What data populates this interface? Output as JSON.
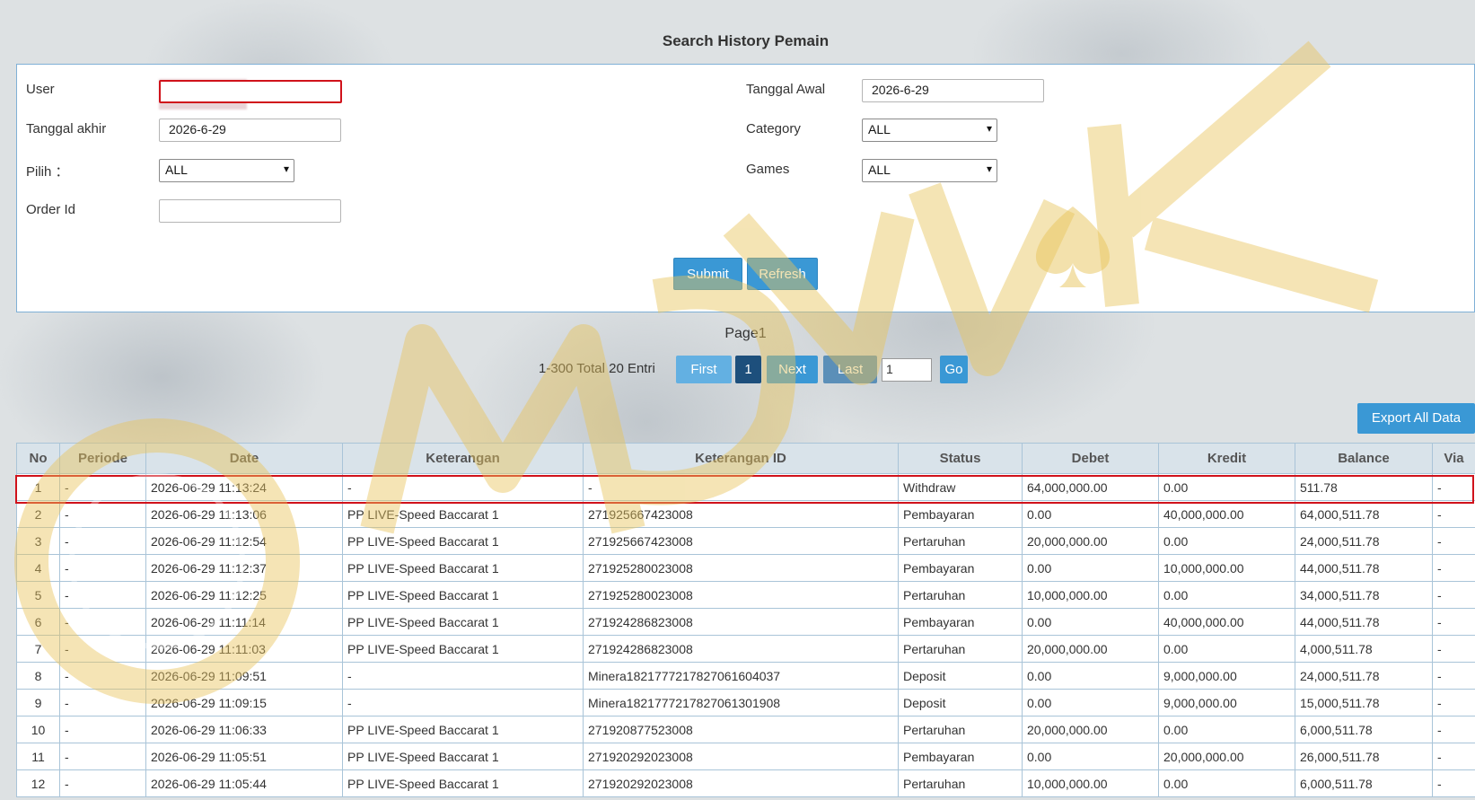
{
  "title": "Search History Pemain",
  "form": {
    "user_label": "User",
    "user_value": "",
    "tanggal_awal_label": "Tanggal Awal",
    "tanggal_awal_value": "2026-6-29",
    "tanggal_akhir_label": "Tanggal akhir",
    "tanggal_akhir_value": "2026-6-29",
    "category_label": "Category",
    "category_value": "ALL",
    "pilih_label": "Pilih ：",
    "pilih_value": "ALL",
    "games_label": "Games",
    "games_value": "ALL",
    "order_id_label": "Order Id",
    "order_id_value": "",
    "submit_label": "Submit",
    "refresh_label": "Refresh"
  },
  "pager": {
    "page_label": "Page1",
    "info": "1-300 Total 20 Entri",
    "first_label": "First",
    "current_page": "1",
    "next_label": "Next",
    "last_label": "Last",
    "page_input_value": "1",
    "go_label": "Go"
  },
  "export_label": "Export All Data",
  "table": {
    "headers": [
      "No",
      "Periode",
      "Date",
      "Keterangan",
      "Keterangan ID",
      "Status",
      "Debet",
      "Kredit",
      "Balance",
      "Via"
    ],
    "rows": [
      [
        "1",
        "-",
        "2026-06-29 11:13:24",
        "-",
        "-",
        "Withdraw",
        "64,000,000.00",
        "0.00",
        "511.78",
        "-"
      ],
      [
        "2",
        "-",
        "2026-06-29 11:13:06",
        "PP LIVE-Speed Baccarat 1",
        "271925667423008",
        "Pembayaran",
        "0.00",
        "40,000,000.00",
        "64,000,511.78",
        "-"
      ],
      [
        "3",
        "-",
        "2026-06-29 11:12:54",
        "PP LIVE-Speed Baccarat 1",
        "271925667423008",
        "Pertaruhan",
        "20,000,000.00",
        "0.00",
        "24,000,511.78",
        "-"
      ],
      [
        "4",
        "-",
        "2026-06-29 11:12:37",
        "PP LIVE-Speed Baccarat 1",
        "271925280023008",
        "Pembayaran",
        "0.00",
        "10,000,000.00",
        "44,000,511.78",
        "-"
      ],
      [
        "5",
        "-",
        "2026-06-29 11:12:25",
        "PP LIVE-Speed Baccarat 1",
        "271925280023008",
        "Pertaruhan",
        "10,000,000.00",
        "0.00",
        "34,000,511.78",
        "-"
      ],
      [
        "6",
        "-",
        "2026-06-29 11:11:14",
        "PP LIVE-Speed Baccarat 1",
        "271924286823008",
        "Pembayaran",
        "0.00",
        "40,000,000.00",
        "44,000,511.78",
        "-"
      ],
      [
        "7",
        "-",
        "2026-06-29 11:11:03",
        "PP LIVE-Speed Baccarat 1",
        "271924286823008",
        "Pertaruhan",
        "20,000,000.00",
        "0.00",
        "4,000,511.78",
        "-"
      ],
      [
        "8",
        "-",
        "2026-06-29 11:09:51",
        "-",
        "Minera1821777217827061604037",
        "Deposit",
        "0.00",
        "9,000,000.00",
        "24,000,511.78",
        "-"
      ],
      [
        "9",
        "-",
        "2026-06-29 11:09:15",
        "-",
        "Minera1821777217827061301908",
        "Deposit",
        "0.00",
        "9,000,000.00",
        "15,000,511.78",
        "-"
      ],
      [
        "10",
        "-",
        "2026-06-29 11:06:33",
        "PP LIVE-Speed Baccarat 1",
        "271920877523008",
        "Pertaruhan",
        "20,000,000.00",
        "0.00",
        "6,000,511.78",
        "-"
      ],
      [
        "11",
        "-",
        "2026-06-29 11:05:51",
        "PP LIVE-Speed Baccarat 1",
        "271920292023008",
        "Pembayaran",
        "0.00",
        "20,000,000.00",
        "26,000,511.78",
        "-"
      ],
      [
        "12",
        "-",
        "2026-06-29 11:05:44",
        "PP LIVE-Speed Baccarat 1",
        "271920292023008",
        "Pertaruhan",
        "10,000,000.00",
        "0.00",
        "6,000,511.78",
        "-"
      ]
    ]
  },
  "colors": {
    "accent": "#3a98d5",
    "link": "#3a8fd0",
    "withdraw_red": "#cc1a1a",
    "deposit_green": "#2e9a1f",
    "highlight_border": "#d0121b",
    "watermark_gold": "#e8c45a"
  },
  "watermark_text": "AWDYUK"
}
